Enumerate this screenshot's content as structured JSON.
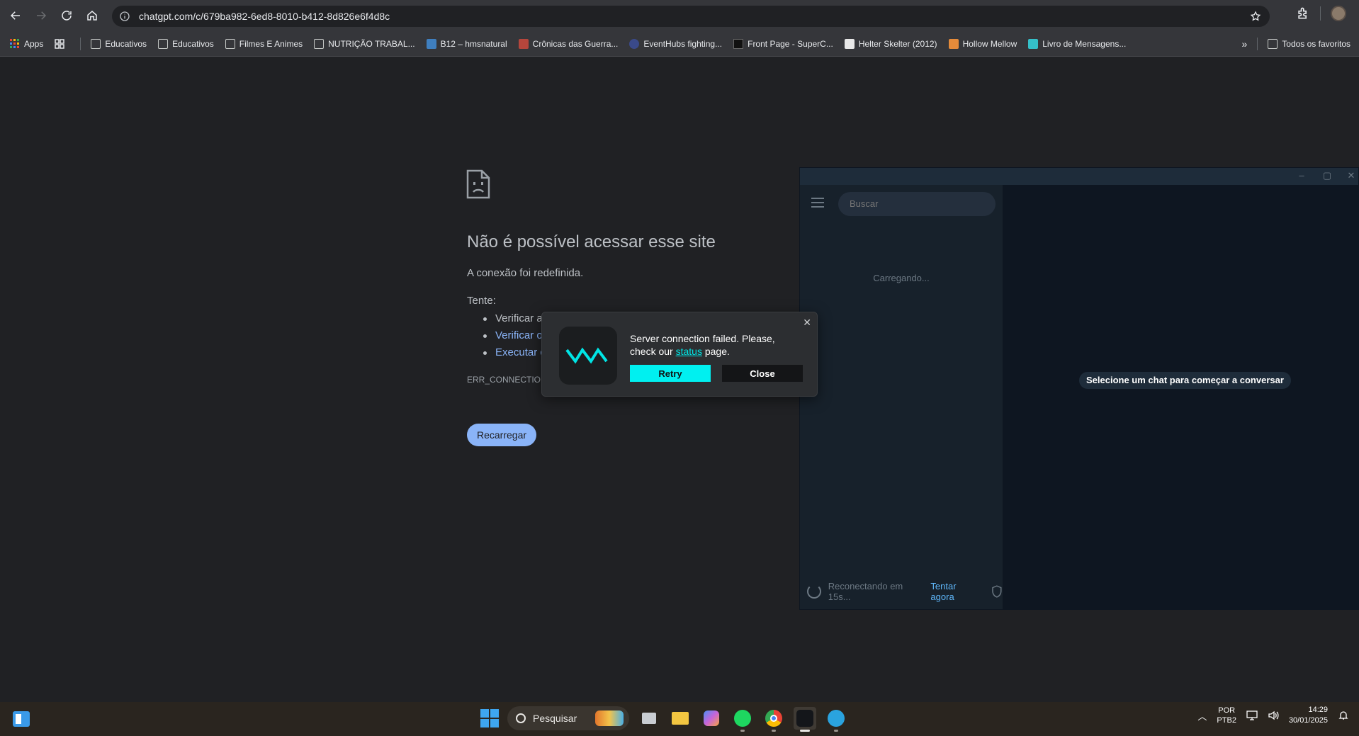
{
  "browser": {
    "url": "chatgpt.com/c/679ba982-6ed8-8010-b412-8d826e6f4d8c"
  },
  "bookmarks": {
    "apps": "Apps",
    "items": [
      {
        "label": "Educativos",
        "icon": "folder-icon"
      },
      {
        "label": "Educativos",
        "icon": "folder-icon"
      },
      {
        "label": "Filmes E Animes",
        "icon": "folder-icon"
      },
      {
        "label": "NUTRIÇÃO TRABAL...",
        "icon": "folder-icon"
      },
      {
        "label": "B12 – hmsnatural",
        "icon": "favicon"
      },
      {
        "label": "Crônicas das Guerra...",
        "icon": "favicon"
      },
      {
        "label": "EventHubs fighting...",
        "icon": "favicon"
      },
      {
        "label": "Front Page - SuperC...",
        "icon": "favicon"
      },
      {
        "label": "Helter Skelter (2012)",
        "icon": "favicon"
      },
      {
        "label": "Hollow Mellow",
        "icon": "favicon"
      },
      {
        "label": "Livro de Mensagens...",
        "icon": "favicon"
      }
    ],
    "all_favorites": "Todos os favoritos"
  },
  "error_page": {
    "title": "Não é possível acessar esse site",
    "subtitle": "A conexão foi redefinida.",
    "try_label": "Tente:",
    "suggestions": [
      "Verificar a",
      "Verificar o",
      "Executar c"
    ],
    "error_code": "ERR_CONNECTION_",
    "reload_button": "Recarregar"
  },
  "telegram": {
    "search_placeholder": "Buscar",
    "loading": "Carregando...",
    "select_chat": "Selecione um chat para começar a conversar",
    "reconnecting": "Reconectando em 15s...",
    "try_now": "Tentar agora"
  },
  "popup": {
    "message_before": "Server connection failed. Please, check our ",
    "status_link": "status",
    "message_after": " page.",
    "retry_button": "Retry",
    "close_button": "Close"
  },
  "taskbar": {
    "search_label": "Pesquisar",
    "lang_line1": "POR",
    "lang_line2": "PTB2",
    "time": "14:29",
    "date": "30/01/2025"
  },
  "colors": {
    "accent_link": "#8ab4f8",
    "popup_retry": "#00f0f0",
    "telegram_link": "#5eb5f7"
  }
}
